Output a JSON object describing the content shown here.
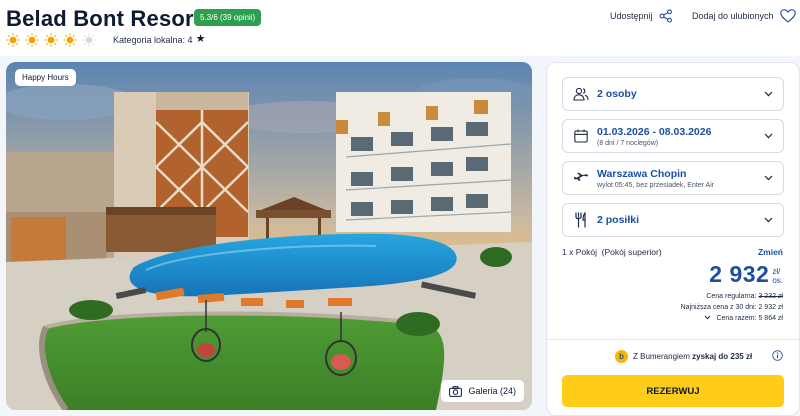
{
  "hotel": {
    "name": "Belad Bont Resort",
    "rating": "5.3/6 (39 opinii)",
    "stars": 5,
    "category_label": "Kategoria lokalna: 4"
  },
  "header_actions": {
    "share_label": "Udostępnij",
    "favorite_label": "Dodaj do ulubionych"
  },
  "photo": {
    "tag": "Happy Hours",
    "gallery_label": "Galeria (24)"
  },
  "booking": {
    "guests": "2 osoby",
    "dates": "01.03.2026 - 08.03.2026",
    "dates_sub": "(8 dni / 7 noclegów)",
    "departure": "Warszawa Chopin",
    "departure_sub": "wylot 05:45, bez przesiadek, Enter Air",
    "meals": "2 posiłki",
    "room": "1 x Pokój  (Pokój superior)",
    "change_label": "Zmień",
    "price": "2 932",
    "price_unit_line1": "zł/",
    "price_unit_line2": "os.",
    "regular_label": "Cena regularna:",
    "regular_value": "3 232 zł",
    "lowest_label": "Najniższa cena z 30 dni:",
    "lowest_value": "2 932 zł",
    "total_label": "Cena razem:",
    "total_value": "5 864 zł",
    "bumerang_prefix": "Z Bumerangiem",
    "bumerang_bold": "zyskaj do 235 zł",
    "bumerang_logo": "b",
    "reserve_label": "REZERWUJ"
  },
  "colors": {
    "accent_blue": "#1d4fa1",
    "rating_green": "#2e9e4f",
    "reserve_yellow": "#ffcd18",
    "star_orange": "#f5a300"
  }
}
